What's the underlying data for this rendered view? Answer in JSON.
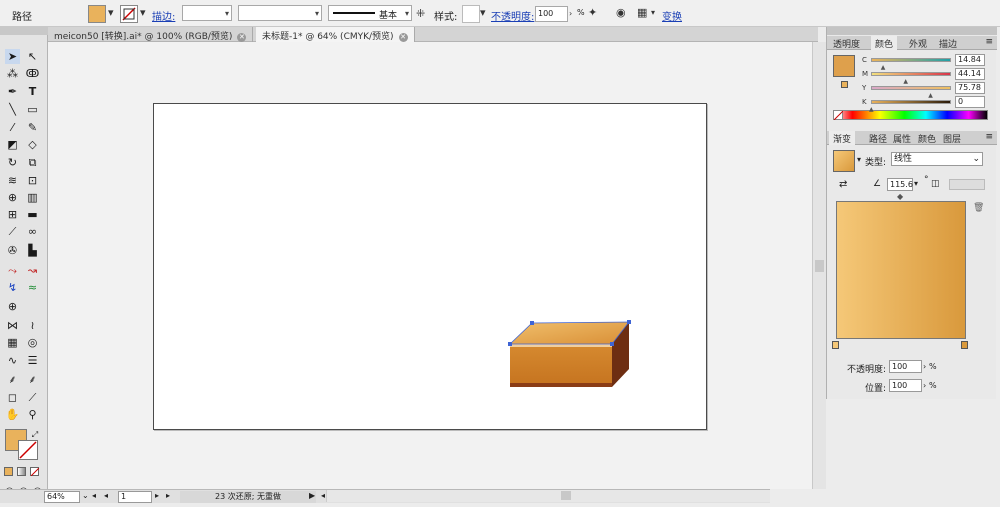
{
  "control_bar": {
    "object_type": "路径",
    "stroke_label": "描边:",
    "stroke_style": "基本",
    "style_label": "样式:",
    "opacity_label": "不透明度:",
    "opacity_value": "100",
    "opacity_unit": "%",
    "transform_label": "变换",
    "fill_color": "#e9b25c"
  },
  "tabs": [
    {
      "label": "meicon50 [转换].ai* @ 100% (RGB/预览)",
      "active": false
    },
    {
      "label": "未标题-1* @ 64% (CMYK/预览)",
      "active": true
    }
  ],
  "color_panel": {
    "tabs": [
      "透明度",
      "颜色",
      "外观",
      "描边"
    ],
    "active_tab": "颜色",
    "channels": [
      {
        "name": "C",
        "value": "14.84",
        "pos": 0.15
      },
      {
        "name": "M",
        "value": "44.14",
        "pos": 0.44
      },
      {
        "name": "Y",
        "value": "75.78",
        "pos": 0.76
      },
      {
        "name": "K",
        "value": "0",
        "pos": 0.0
      }
    ],
    "swatch_color": "#dea04c"
  },
  "gradient_panel": {
    "tabs": [
      "渐变",
      "路径",
      "属性",
      "颜色",
      "图层"
    ],
    "active_tab": "渐变",
    "type_label": "类型:",
    "type_value": "线性",
    "angle_value": "115.6",
    "angle_unit": "°",
    "opacity_label": "不透明度:",
    "opacity_value": "100",
    "position_label": "位置:",
    "position_value": "100",
    "percent": "%",
    "gradient_start": "#f5c878",
    "gradient_end": "#d9993c"
  },
  "status_bar": {
    "zoom": "64%",
    "page": "1",
    "undo_text": "23 次还原; 无重做"
  },
  "artwork": {
    "box_top_color": "#e4a552",
    "box_front_color": "#cb7a22",
    "box_side_color": "#6e2e12",
    "selection_color": "#3e64d4"
  }
}
